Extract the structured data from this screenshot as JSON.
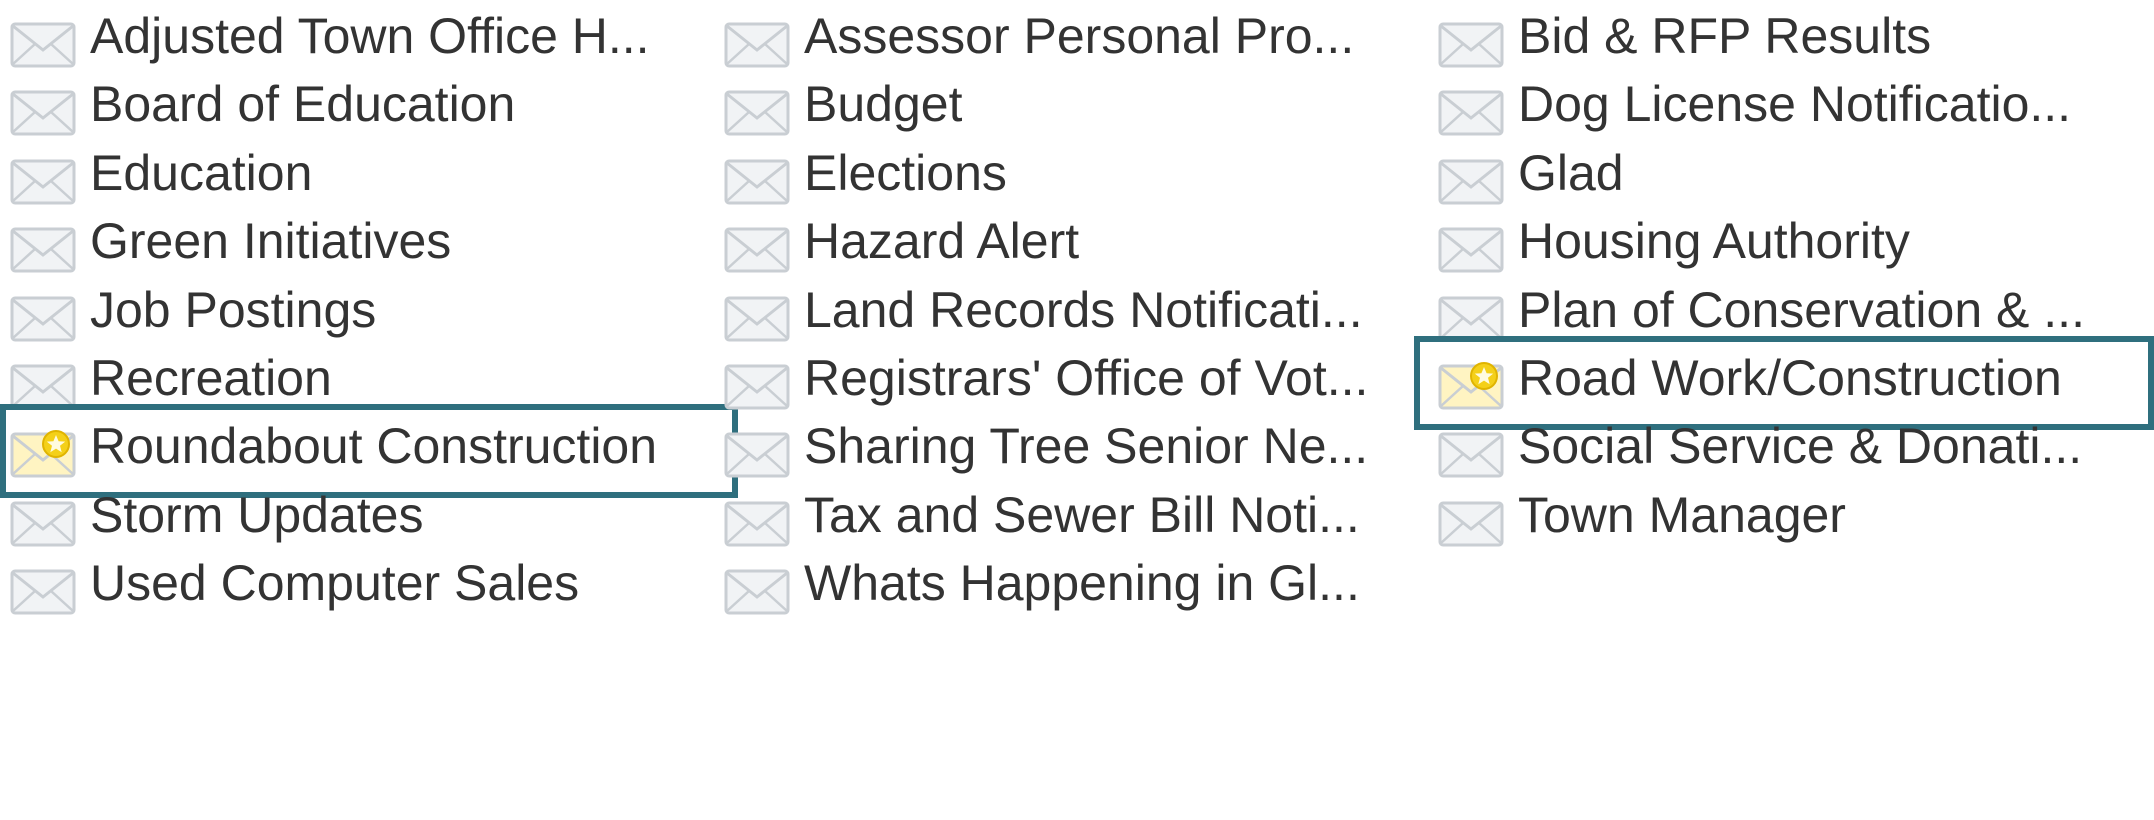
{
  "colors": {
    "text": "#333333",
    "selection_border": "#2f6f7e",
    "envelope_gray": "#c9ced3",
    "envelope_cream": "#fff4c2",
    "star_yellow": "#f4d019"
  },
  "columns": [
    {
      "items": [
        {
          "label": "Adjusted Town Office H...",
          "icon": "envelope-icon",
          "selected": false
        },
        {
          "label": "Board of Education",
          "icon": "envelope-icon",
          "selected": false
        },
        {
          "label": "Education",
          "icon": "envelope-icon",
          "selected": false
        },
        {
          "label": "Green Initiatives",
          "icon": "envelope-icon",
          "selected": false
        },
        {
          "label": "Job Postings",
          "icon": "envelope-icon",
          "selected": false
        },
        {
          "label": "Recreation",
          "icon": "envelope-icon",
          "selected": false
        },
        {
          "label": "Roundabout Construction",
          "icon": "envelope-star-icon",
          "selected": true
        },
        {
          "label": "Storm Updates",
          "icon": "envelope-icon",
          "selected": false
        },
        {
          "label": "Used Computer Sales",
          "icon": "envelope-icon",
          "selected": false
        }
      ]
    },
    {
      "items": [
        {
          "label": "Assessor Personal Pro...",
          "icon": "envelope-icon",
          "selected": false
        },
        {
          "label": "Budget",
          "icon": "envelope-icon",
          "selected": false
        },
        {
          "label": "Elections",
          "icon": "envelope-icon",
          "selected": false
        },
        {
          "label": "Hazard Alert",
          "icon": "envelope-icon",
          "selected": false
        },
        {
          "label": "Land Records Notificati...",
          "icon": "envelope-icon",
          "selected": false
        },
        {
          "label": "Registrars' Office of Vot...",
          "icon": "envelope-icon",
          "selected": false
        },
        {
          "label": "Sharing Tree Senior Ne...",
          "icon": "envelope-icon",
          "selected": false
        },
        {
          "label": "Tax and Sewer Bill Noti...",
          "icon": "envelope-icon",
          "selected": false
        },
        {
          "label": "Whats Happening in Gl...",
          "icon": "envelope-icon",
          "selected": false
        }
      ]
    },
    {
      "items": [
        {
          "label": "Bid & RFP Results",
          "icon": "envelope-icon",
          "selected": false
        },
        {
          "label": "Dog License Notificatio...",
          "icon": "envelope-icon",
          "selected": false
        },
        {
          "label": "Glad",
          "icon": "envelope-icon",
          "selected": false
        },
        {
          "label": "Housing Authority",
          "icon": "envelope-icon",
          "selected": false
        },
        {
          "label": "Plan of Conservation & ...",
          "icon": "envelope-icon",
          "selected": false
        },
        {
          "label": "Road Work/Construction",
          "icon": "envelope-star-icon",
          "selected": true
        },
        {
          "label": "Social Service & Donati...",
          "icon": "envelope-icon",
          "selected": false
        },
        {
          "label": "Town Manager",
          "icon": "envelope-icon",
          "selected": false
        }
      ]
    }
  ]
}
